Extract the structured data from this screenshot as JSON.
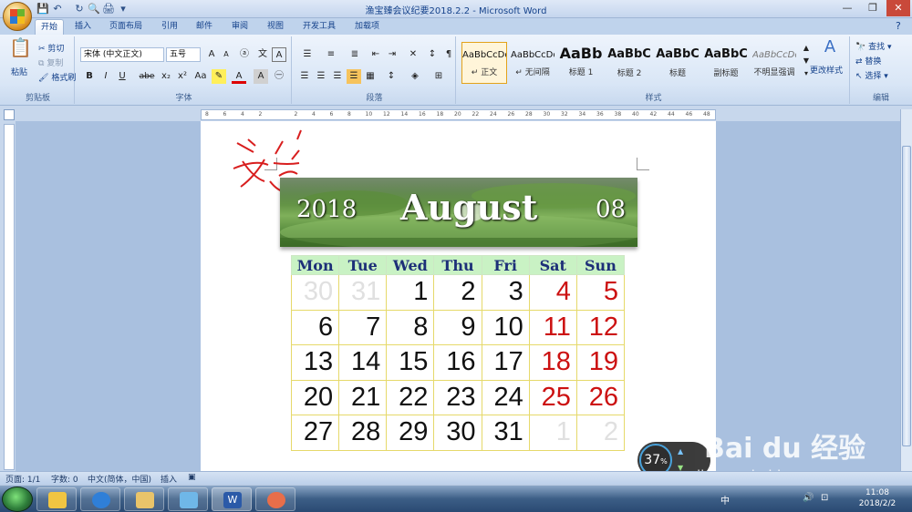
{
  "window": {
    "title": "渔宝臻会议纪要2018.2.2 - Microsoft Word"
  },
  "tabs": [
    {
      "label": "开始",
      "active": true
    },
    {
      "label": "插入"
    },
    {
      "label": "页面布局"
    },
    {
      "label": "引用"
    },
    {
      "label": "邮件"
    },
    {
      "label": "审阅"
    },
    {
      "label": "视图"
    },
    {
      "label": "开发工具"
    },
    {
      "label": "加载项"
    }
  ],
  "ribbon": {
    "clipboard": {
      "name": "剪贴板",
      "paste": "粘贴",
      "cut": "剪切",
      "copy": "复制",
      "format_painter": "格式刷"
    },
    "font": {
      "name": "字体",
      "face": "宋体 (中文正文)",
      "size": "五号",
      "bold": "B",
      "italic": "I",
      "underline": "U",
      "strike": "abe",
      "sub": "x₂",
      "sup": "x²",
      "case": "Aa"
    },
    "paragraph": {
      "name": "段落"
    },
    "styles": {
      "name": "样式",
      "items": [
        {
          "preview": "AaBbCcDd",
          "label": "↵ 正文"
        },
        {
          "preview": "AaBbCcDd",
          "label": "↵ 无间隔"
        },
        {
          "preview": "AaBb",
          "label": "标题 1"
        },
        {
          "preview": "AaBbC",
          "label": "标题 2"
        },
        {
          "preview": "AaBbC",
          "label": "标题"
        },
        {
          "preview": "AaBbC",
          "label": "副标题"
        },
        {
          "preview": "AaBbCcDd",
          "label": "不明显强调"
        }
      ],
      "change_styles": "更改样式"
    },
    "editing": {
      "name": "编辑",
      "find": "查找",
      "replace": "替换",
      "select": "选择"
    }
  },
  "ruler": {
    "ticks": [
      "8",
      "6",
      "4",
      "2",
      "",
      "2",
      "4",
      "6",
      "8",
      "10",
      "12",
      "14",
      "16",
      "18",
      "20",
      "22",
      "24",
      "26",
      "28",
      "30",
      "32",
      "34",
      "36",
      "38",
      "40",
      "42",
      "44",
      "46",
      "48"
    ]
  },
  "handwriting": "文字",
  "calendar": {
    "year": "2018",
    "month_name": "August",
    "month_num": "08",
    "weekdays": [
      "Mon",
      "Tue",
      "Wed",
      "Thu",
      "Fri",
      "Sat",
      "Sun"
    ],
    "weeks": [
      [
        "30",
        "31",
        "1",
        "2",
        "3",
        "4",
        "5"
      ],
      [
        "6",
        "7",
        "8",
        "9",
        "10",
        "11",
        "12"
      ],
      [
        "13",
        "14",
        "15",
        "16",
        "17",
        "18",
        "19"
      ],
      [
        "20",
        "21",
        "22",
        "23",
        "24",
        "25",
        "26"
      ],
      [
        "27",
        "28",
        "29",
        "30",
        "31",
        "1",
        "2"
      ]
    ]
  },
  "status": {
    "page": "页面: 1/1",
    "words": "字数: 0",
    "language": "中文(简体，中国)",
    "mode": "插入"
  },
  "taskbar": {
    "time": "11:08",
    "date": "2018/2/2",
    "ime": "中"
  },
  "overlay": {
    "gauge": "37",
    "watermark": "Bai du 经验",
    "url": "jingyan.baidu.com"
  },
  "colors": {
    "weekend": "#cc1111",
    "header_bg": "#c9f2c4",
    "grid_line": "#e6d96a"
  }
}
